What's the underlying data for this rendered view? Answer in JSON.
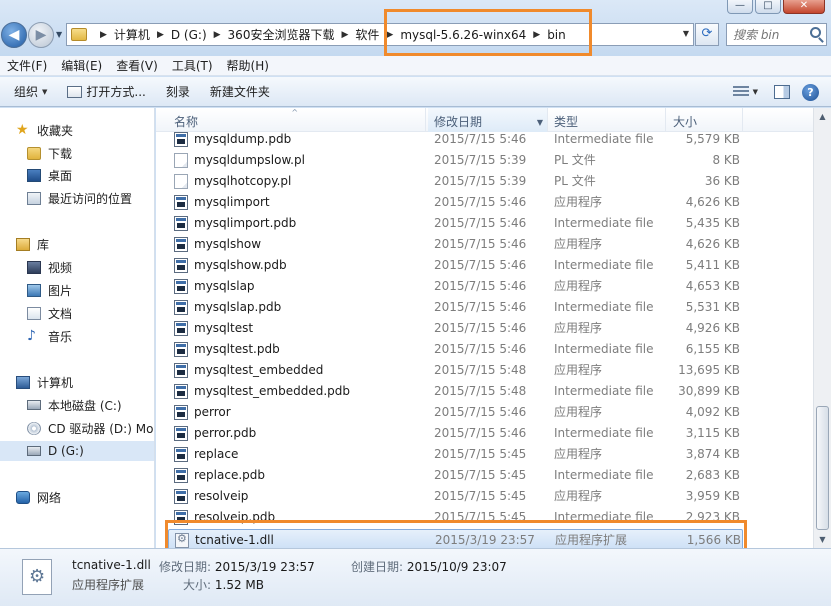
{
  "window": {
    "min_label": "—",
    "max_label": "□",
    "close_label": "✕"
  },
  "nav": {
    "back_glyph": "◀",
    "forward_glyph": "▶"
  },
  "breadcrumb": [
    "计算机",
    "D (G:)",
    "360安全浏览器下载",
    "软件",
    "mysql-5.6.26-winx64",
    "bin"
  ],
  "search": {
    "placeholder": "搜索 bin"
  },
  "menu": [
    "文件(F)",
    "编辑(E)",
    "查看(V)",
    "工具(T)",
    "帮助(H)"
  ],
  "toolbar": {
    "organize": "组织",
    "open_with": "打开方式...",
    "burn": "刻录",
    "new_folder": "新建文件夹"
  },
  "navpane": {
    "favorites": "收藏夹",
    "downloads": "下载",
    "desktop": "桌面",
    "recent": "最近访问的位置",
    "library": "库",
    "videos": "视频",
    "pictures": "图片",
    "documents": "文档",
    "music": "音乐",
    "computer": "计算机",
    "disk_c": "本地磁盘 (C:)",
    "disk_d": "CD 驱动器 (D:) Mo",
    "disk_g": "D (G:)",
    "network": "网络"
  },
  "columns": {
    "name": "名称",
    "date": "修改日期",
    "type": "类型",
    "size": "大小"
  },
  "files": [
    {
      "name": "mysqldump.pdb",
      "date": "2015/7/15 5:46",
      "type": "Intermediate file",
      "size": "5,579 KB",
      "icon": "pdb-icon"
    },
    {
      "name": "mysqldumpslow.pl",
      "date": "2015/7/15 5:39",
      "type": "PL 文件",
      "size": "8 KB",
      "icon": "pl-icon"
    },
    {
      "name": "mysqlhotcopy.pl",
      "date": "2015/7/15 5:39",
      "type": "PL 文件",
      "size": "36 KB",
      "icon": "pl-icon"
    },
    {
      "name": "mysqlimport",
      "date": "2015/7/15 5:46",
      "type": "应用程序",
      "size": "4,626 KB",
      "icon": "exe-icon"
    },
    {
      "name": "mysqlimport.pdb",
      "date": "2015/7/15 5:46",
      "type": "Intermediate file",
      "size": "5,435 KB",
      "icon": "pdb-icon"
    },
    {
      "name": "mysqlshow",
      "date": "2015/7/15 5:46",
      "type": "应用程序",
      "size": "4,626 KB",
      "icon": "exe-icon"
    },
    {
      "name": "mysqlshow.pdb",
      "date": "2015/7/15 5:46",
      "type": "Intermediate file",
      "size": "5,411 KB",
      "icon": "pdb-icon"
    },
    {
      "name": "mysqlslap",
      "date": "2015/7/15 5:46",
      "type": "应用程序",
      "size": "4,653 KB",
      "icon": "exe-icon"
    },
    {
      "name": "mysqlslap.pdb",
      "date": "2015/7/15 5:46",
      "type": "Intermediate file",
      "size": "5,531 KB",
      "icon": "pdb-icon"
    },
    {
      "name": "mysqltest",
      "date": "2015/7/15 5:46",
      "type": "应用程序",
      "size": "4,926 KB",
      "icon": "exe-icon"
    },
    {
      "name": "mysqltest.pdb",
      "date": "2015/7/15 5:46",
      "type": "Intermediate file",
      "size": "6,155 KB",
      "icon": "pdb-icon"
    },
    {
      "name": "mysqltest_embedded",
      "date": "2015/7/15 5:48",
      "type": "应用程序",
      "size": "13,695 KB",
      "icon": "exe-icon"
    },
    {
      "name": "mysqltest_embedded.pdb",
      "date": "2015/7/15 5:48",
      "type": "Intermediate file",
      "size": "30,899 KB",
      "icon": "pdb-icon"
    },
    {
      "name": "perror",
      "date": "2015/7/15 5:46",
      "type": "应用程序",
      "size": "4,092 KB",
      "icon": "exe-icon"
    },
    {
      "name": "perror.pdb",
      "date": "2015/7/15 5:46",
      "type": "Intermediate file",
      "size": "3,115 KB",
      "icon": "pdb-icon"
    },
    {
      "name": "replace",
      "date": "2015/7/15 5:45",
      "type": "应用程序",
      "size": "3,874 KB",
      "icon": "exe-icon"
    },
    {
      "name": "replace.pdb",
      "date": "2015/7/15 5:45",
      "type": "Intermediate file",
      "size": "2,683 KB",
      "icon": "pdb-icon"
    },
    {
      "name": "resolveip",
      "date": "2015/7/15 5:45",
      "type": "应用程序",
      "size": "3,959 KB",
      "icon": "exe-icon"
    },
    {
      "name": "resolveip.pdb",
      "date": "2015/7/15 5:45",
      "type": "Intermediate file",
      "size": "2,923 KB",
      "icon": "pdb-icon"
    },
    {
      "name": "tcnative-1.dll",
      "date": "2015/3/19 23:57",
      "type": "应用程序扩展",
      "size": "1,566 KB",
      "icon": "dll-icon",
      "selected": true
    }
  ],
  "details": {
    "name": "tcnative-1.dll",
    "type": "应用程序扩展",
    "modified_label": "修改日期:",
    "modified_value": "2015/3/19 23:57",
    "created_label": "创建日期:",
    "created_value": "2015/10/9 23:07",
    "size_label": "大小:",
    "size_value": "1.52 MB"
  },
  "colors": {
    "highlight": "#f08a2c",
    "selection": "#cde0f6"
  }
}
